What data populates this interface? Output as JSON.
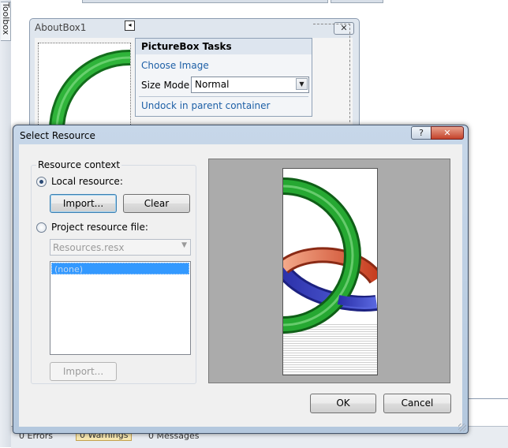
{
  "designer": {
    "toolbox_tab": "Toolbox",
    "about_box": {
      "title": "AboutBox1",
      "close_glyph": "✕"
    },
    "smart_tag_glyph": "◂",
    "tasks": {
      "title": "PictureBox Tasks",
      "choose_image": "Choose Image",
      "size_mode_label": "Size Mode",
      "size_mode_value": "Normal",
      "dropdown_glyph": "▼",
      "undock": "Undock in parent container"
    },
    "status": {
      "errors": "0 Errors",
      "warnings": "0 Warnings",
      "messages": "0 Messages"
    }
  },
  "dialog": {
    "title": "Select Resource",
    "help_glyph": "?",
    "close_glyph": "✕",
    "context_legend": "Resource context",
    "local_resource_label": "Local resource:",
    "local_selected": true,
    "import_label": "Import...",
    "clear_label": "Clear",
    "project_resource_label": "Project resource file:",
    "resx_value": "Resources.resx",
    "dropdown_glyph": "▼",
    "list_items": [
      "(none)"
    ],
    "import_disabled_label": "Import...",
    "ok_label": "OK",
    "cancel_label": "Cancel"
  },
  "colors": {
    "ring_green": "#1e9a2a",
    "ring_orange": "#e0502a",
    "ring_blue": "#2a36b5",
    "link": "#1d5fa6",
    "selection": "#3399ff",
    "preview_bg": "#ababab"
  }
}
